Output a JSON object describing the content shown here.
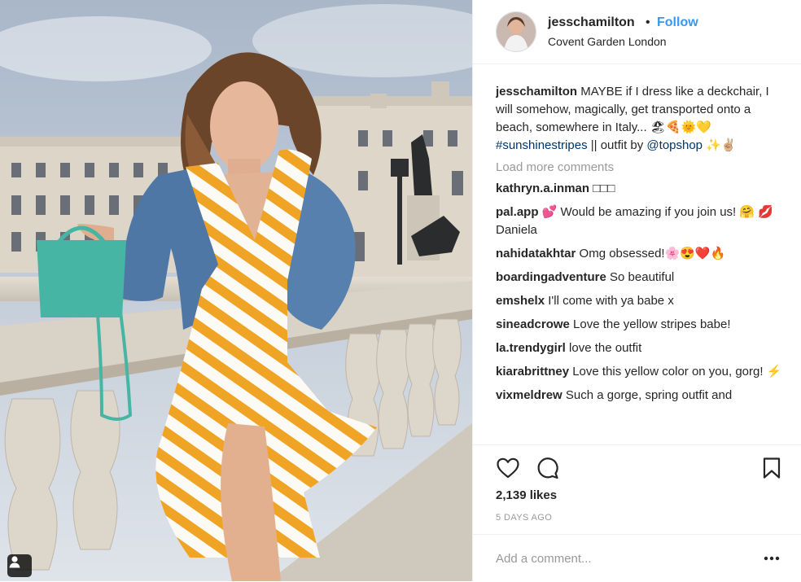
{
  "colors": {
    "link": "#3897f0",
    "text": "#262626",
    "muted": "#999999",
    "hashtag": "#003569"
  },
  "header": {
    "username": "jesschamilton",
    "separator": "•",
    "follow_label": "Follow",
    "location": "Covent Garden London"
  },
  "caption": {
    "username": "jesschamilton",
    "text": "MAYBE if I dress like a deckchair, I will somehow, magically, get transported onto a beach, somewhere in Italy... 🏖🍕🌞💛",
    "hashtag": "#sunshinestripes",
    "mid": "|| outfit by",
    "mention": "@topshop",
    "end": "✨✌🏼"
  },
  "load_more_label": "Load more comments",
  "comments": [
    {
      "username": "kathryn.a.inman",
      "text": "□□□"
    },
    {
      "username": "pal.app",
      "text": "💕 Would be amazing if you join us! 🤗 💋 Daniela"
    },
    {
      "username": "nahidatakhtar",
      "text": "Omg obsessed!🌸😍❤️🔥"
    },
    {
      "username": "boardingadventure",
      "text": "So beautiful"
    },
    {
      "username": "emshelx",
      "text": "I'll come with ya babe x"
    },
    {
      "username": "sineadcrowe",
      "text": "Love the yellow stripes babe!"
    },
    {
      "username": "la.trendygirl",
      "text": "love the outfit"
    },
    {
      "username": "kiarabrittney",
      "text": "Love this yellow color on you, gorg! ⚡"
    },
    {
      "username": "vixmeldrew",
      "text": "Such a gorge, spring outfit and"
    }
  ],
  "icons": {
    "like": "heart-icon",
    "comment": "comment-bubble-icon",
    "save": "bookmark-icon",
    "more": "more-dots-icon",
    "tag": "user-tag-icon"
  },
  "likes": "2,139 likes",
  "time": "5 DAYS AGO",
  "add_comment_placeholder": "Add a comment..."
}
